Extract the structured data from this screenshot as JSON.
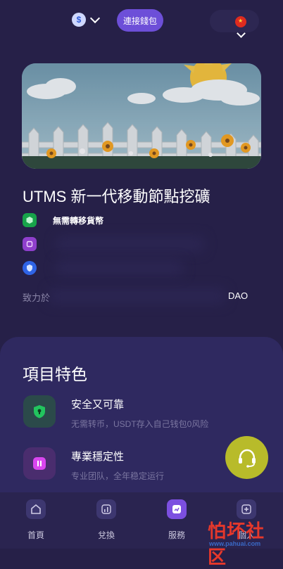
{
  "header": {
    "coin_icon": "dollar-coin-icon",
    "connect_label": "連接錢包",
    "flag_icon": "china-flag-icon"
  },
  "banner": {
    "image": "cartoon-garden-sunflowers-fence"
  },
  "hero": {
    "title": "UTMS 新一代移動節點挖礦",
    "features": [
      {
        "icon": "green-hex-icon",
        "label": "無需轉移貨幣"
      },
      {
        "icon": "purple-chip-icon",
        "label": ""
      },
      {
        "icon": "blue-shield-icon",
        "label": ""
      }
    ],
    "dedicate_prefix": "致力於",
    "dao_text": "DAO"
  },
  "features_section": {
    "title": "項目特色",
    "items": [
      {
        "title": "安全又可靠",
        "desc": "无需转币，USDT存入自己钱包0风险",
        "icon": "shield-lock-icon"
      },
      {
        "title": "專業穩定性",
        "desc": "专业团队，全年稳定运行",
        "icon": "pause-chart-icon"
      }
    ]
  },
  "support": {
    "icon": "headset-icon"
  },
  "nav": {
    "items": [
      {
        "label": "首頁",
        "icon": "home-icon"
      },
      {
        "label": "兌換",
        "icon": "exchange-icon"
      },
      {
        "label": "服務",
        "icon": "service-icon"
      },
      {
        "label": "個人",
        "icon": "personal-icon"
      }
    ]
  },
  "watermark": {
    "big": "怕坏社区",
    "small": "www.pahuai.com"
  },
  "colors": {
    "accent": "#6d4fd8",
    "background": "#262048",
    "panel": "#2f2960",
    "support": "#b8bb2a"
  }
}
